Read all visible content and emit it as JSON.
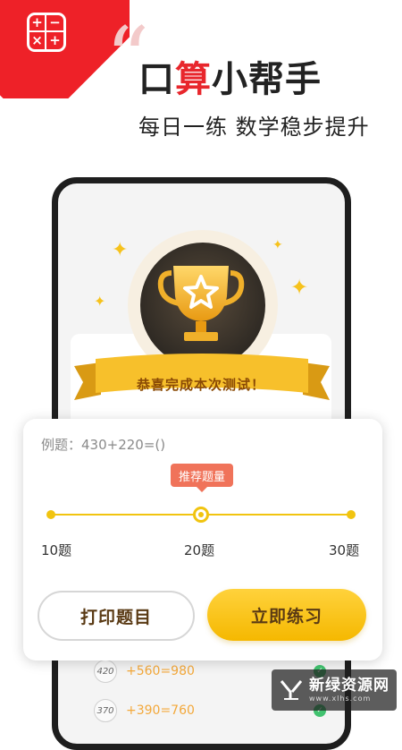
{
  "promo": {
    "title_part1": "口",
    "title_highlight": "算",
    "title_part2": "小帮手",
    "subtitle": "每日一练 数学稳步提升",
    "quote_mark": "“",
    "accent_color": "#ee2128"
  },
  "app_icon": {
    "symbols": [
      "+",
      "−",
      "×",
      "+"
    ]
  },
  "phone_screen": {
    "ribbon_text": "恭喜完成本次测试！",
    "list": [
      {
        "num": "420",
        "eq": "+560=980"
      },
      {
        "num": "370",
        "eq": "+390=760"
      }
    ]
  },
  "settings_sheet": {
    "example": "例题：430+220=()",
    "tooltip": "推荐题量",
    "slider": {
      "min_label": "10题",
      "mid_label": "20题",
      "max_label": "30题",
      "value": 20,
      "min": 10,
      "max": 30
    },
    "print_button": "打印题目",
    "practice_button": "立即练习"
  },
  "watermark": {
    "main": "新绿资源网",
    "sub": "www.xlhs.com"
  }
}
